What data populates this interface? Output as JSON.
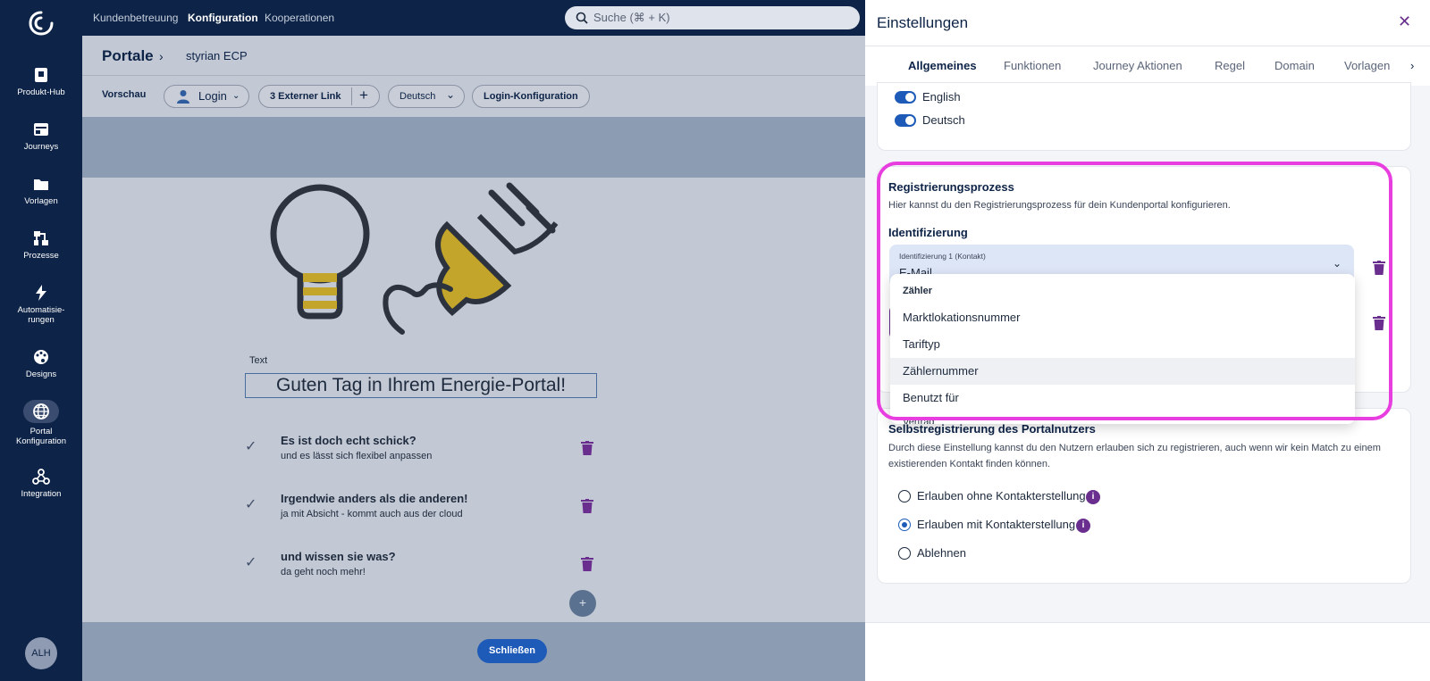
{
  "rail": {
    "items": [
      {
        "label": "Produkt-Hub",
        "icon": "product-hub-icon"
      },
      {
        "label": "Journeys",
        "icon": "journeys-icon"
      },
      {
        "label": "Vorlagen",
        "icon": "folder-icon"
      },
      {
        "label": "Prozesse",
        "icon": "process-icon"
      },
      {
        "label": "Automatisie-rungen",
        "label_line1": "Automatisie-",
        "label_line2": "rungen",
        "icon": "lightning-icon"
      },
      {
        "label": "Designs",
        "icon": "palette-icon"
      },
      {
        "label": "Portal Konfiguration",
        "label_line1": "Portal",
        "label_line2": "Konfiguration",
        "icon": "globe-icon"
      },
      {
        "label": "Integration",
        "icon": "webhook-icon"
      }
    ],
    "avatar": "ALH"
  },
  "topnav": {
    "links": [
      "Kundenbetreuung",
      "Konfiguration",
      "Kooperationen"
    ],
    "active": "Konfiguration",
    "search_placeholder": "Suche (⌘ + K)"
  },
  "pagehead": {
    "title": "Portale",
    "crumb": "styrian ECP"
  },
  "toolbar": {
    "label": "Vorschau",
    "login": "Login",
    "external_link": "3 Externer Link",
    "add": "+",
    "language": "Deutsch",
    "login_config": "Login-Konfiguration"
  },
  "preview": {
    "text_tag": "Text",
    "greeting": "Guten Tag in Ihrem Energie-Portal!",
    "features": [
      {
        "title": "Es ist doch echt schick?",
        "subtitle": "und es lässt sich flexibel anpassen"
      },
      {
        "title": "Irgendwie anders als die anderen!",
        "subtitle": "ja mit Absicht - kommt auch aus der cloud"
      },
      {
        "title": "und wissen sie was?",
        "subtitle": "da geht noch mehr!"
      }
    ],
    "add_button": "+"
  },
  "panel": {
    "title": "Einstellungen",
    "tabs": [
      "Allgemeines",
      "Funktionen",
      "Journey Aktionen",
      "Regel",
      "Domain",
      "Vorlagen"
    ],
    "active_tab": "Allgemeines",
    "languages": [
      {
        "label": "English",
        "enabled": true
      },
      {
        "label": "Deutsch",
        "enabled": true
      }
    ],
    "registration": {
      "title": "Registrierungsprozess",
      "description": "Hier kannst du den Registrierungsprozess für dein Kundenportal konfigurieren.",
      "ident_title": "Identifizierung",
      "field_label": "Identifizierung 1 (Kontakt)",
      "field_value": "E-Mail"
    },
    "dropdown": {
      "group": "Zähler",
      "options": [
        "Marktlokationsnummer",
        "Tariftyp",
        "Zählernummer",
        "Benutzt für"
      ],
      "highlighted": "Zählernummer",
      "cut_off": "Vertrag"
    },
    "self_registration": {
      "title": "Selbstregistrierung des Portalnutzers",
      "description": "Durch diese Einstellung kannst du den Nutzern erlauben sich zu registrieren, auch wenn wir kein Match zu einem existierenden Kontakt finden können.",
      "options": [
        {
          "label": "Erlauben ohne Kontakterstellung",
          "selected": false,
          "info": true
        },
        {
          "label": "Erlauben mit Kontakterstellung",
          "selected": true,
          "info": true
        },
        {
          "label": "Ablehnen",
          "selected": false,
          "info": false
        }
      ]
    },
    "close_button": "Schließen"
  },
  "colors": {
    "navy": "#0d2347",
    "accent_blue": "#1e5bb8",
    "purple": "#6a2f8e",
    "highlight_magenta": "#e83ee0",
    "bulb_yellow": "#c4a52c"
  }
}
